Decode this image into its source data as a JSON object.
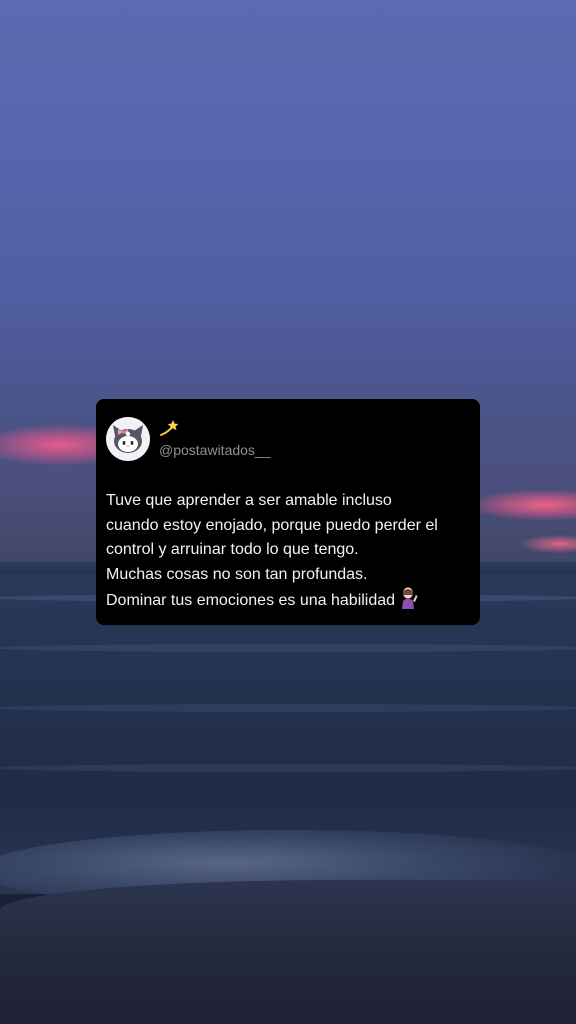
{
  "post": {
    "handle": "@postawitados__",
    "name_icon": "dizzy-star-icon",
    "avatar_icon": "kuromi-avatar-icon",
    "text_lines": [
      "Tuve que aprender a ser amable incluso",
      "cuando estoy enojado, porque puedo perder el",
      "control y arruinar todo lo que tengo.",
      "Muchas cosas no son tan profundas.",
      "Dominar tus emociones es una habilidad"
    ],
    "end_icon": "woman-tipping-hand-icon"
  },
  "colors": {
    "card_background": "#000000",
    "text": "#f2f2f2",
    "handle": "#8f8f93",
    "sky": "#5565ad",
    "sunset_glow": "#ff6f8c",
    "sea": "#22304d"
  }
}
